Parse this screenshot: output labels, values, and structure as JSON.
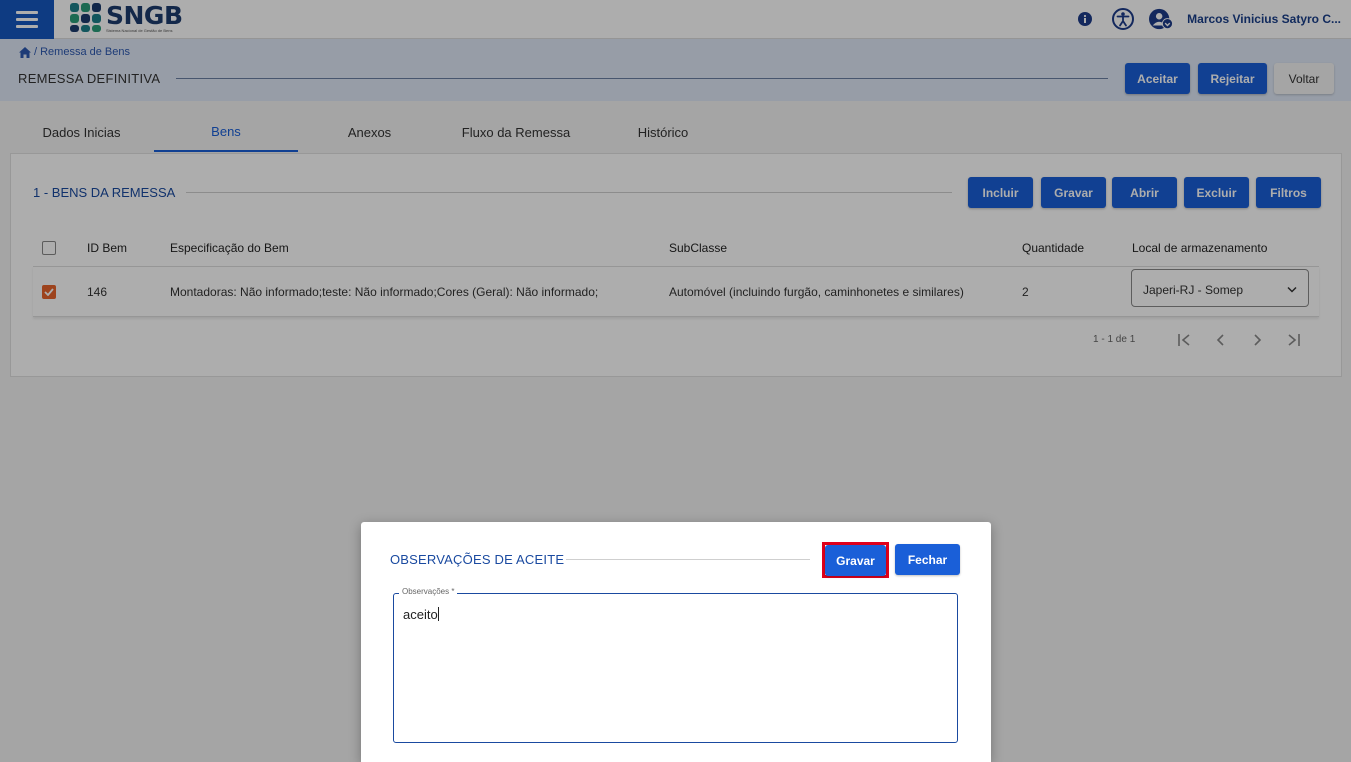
{
  "app": {
    "logo_title": "SNGB",
    "logo_subtitle": "Sistema Nacional de Gestão de Bens",
    "user_name": "Marcos Vinicius Satyro C..."
  },
  "header": {
    "breadcrumb": "/ Remessa de Bens",
    "title": "REMESSA DEFINITIVA",
    "buttons": {
      "accept": "Aceitar",
      "reject": "Rejeitar",
      "back": "Voltar"
    }
  },
  "tabs": [
    {
      "label": "Dados Inicias",
      "active": false
    },
    {
      "label": "Bens",
      "active": true
    },
    {
      "label": "Anexos",
      "active": false
    },
    {
      "label": "Fluxo da Remessa",
      "active": false
    },
    {
      "label": "Histórico",
      "active": false
    }
  ],
  "section": {
    "title": "1 - BENS DA REMESSA",
    "buttons": {
      "include": "Incluir",
      "save": "Gravar",
      "open": "Abrir",
      "delete": "Excluir",
      "filters": "Filtros"
    }
  },
  "table": {
    "columns": [
      "ID Bem",
      "Especificação do Bem",
      "SubClasse",
      "Quantidade",
      "Local de armazenamento"
    ],
    "rows": [
      {
        "checked": true,
        "id": "146",
        "spec": "Montadoras: Não informado;teste: Não informado;Cores (Geral): Não informado;",
        "subclass": "Automóvel (incluindo furgão, caminhonetes e similares)",
        "quantity": "2",
        "location": "Japeri-RJ - Somep"
      }
    ],
    "pagination": "1 - 1 de 1"
  },
  "modal": {
    "title": "OBSERVAÇÕES DE ACEITE",
    "save_label": "Gravar",
    "close_label": "Fechar",
    "field_label": "Observações *",
    "field_value": "aceito"
  },
  "colors": {
    "primary": "#1a5fd8",
    "title_blue": "#1a4aa0",
    "checkbox_checked": "#e8642b",
    "highlight": "#e0001a"
  },
  "icons": [
    "menu-icon",
    "home-icon",
    "info-icon",
    "accessibility-icon",
    "user-account-icon",
    "chevron-down-icon",
    "first-page-icon",
    "prev-page-icon",
    "next-page-icon",
    "last-page-icon",
    "check-icon"
  ]
}
